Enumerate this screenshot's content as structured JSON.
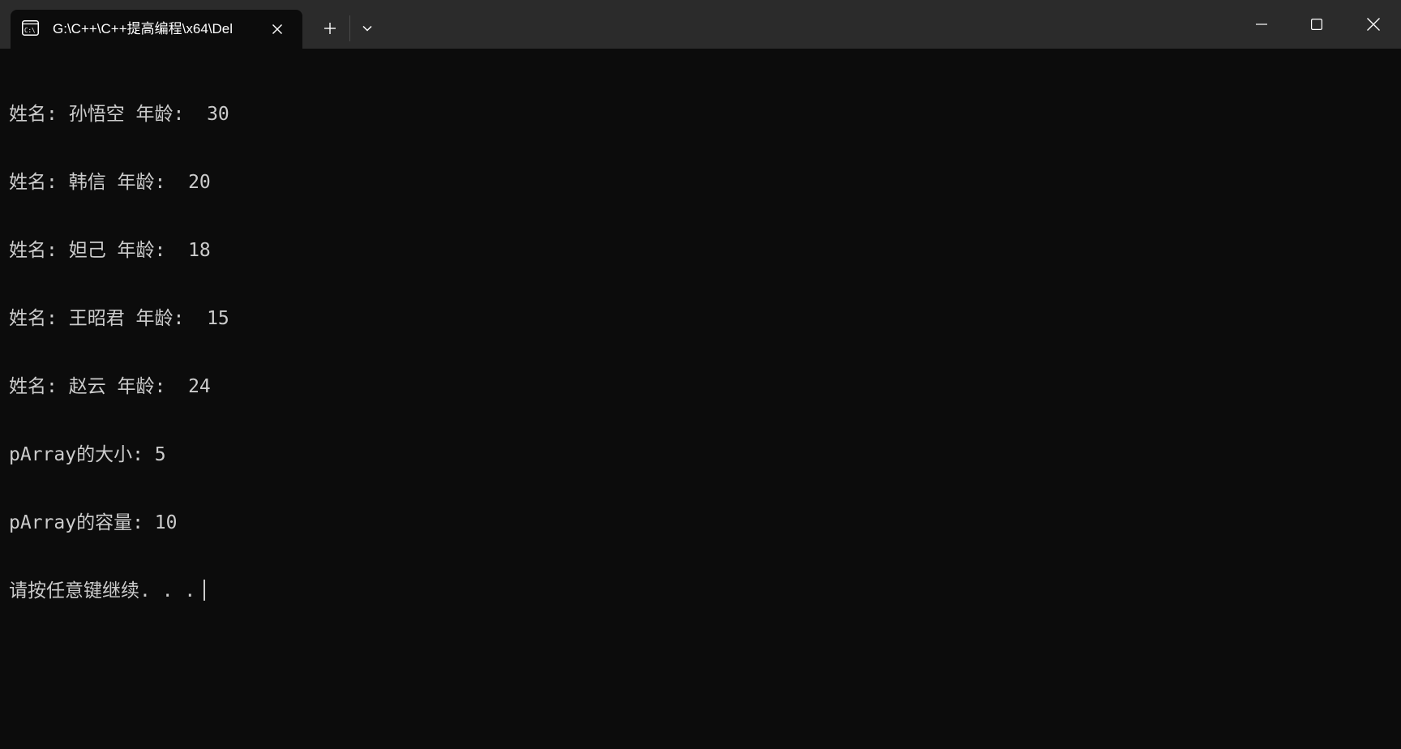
{
  "window": {
    "tab_title": "G:\\C++\\C++提高编程\\x64\\Del",
    "icons": {
      "tab_icon": "console-icon",
      "tab_close": "close-icon",
      "new_tab": "plus-icon",
      "dropdown": "chevron-down-icon",
      "minimize": "minimize-icon",
      "maximize": "maximize-icon",
      "close": "close-icon"
    },
    "colors": {
      "titlebar": "#2b2b2b",
      "background": "#0c0c0c",
      "text": "#cccccc"
    }
  },
  "console": {
    "lines": [
      "姓名: 孙悟空 年龄:  30",
      "姓名: 韩信 年龄:  20",
      "姓名: 妲己 年龄:  18",
      "姓名: 王昭君 年龄:  15",
      "姓名: 赵云 年龄:  24",
      "pArray的大小: 5",
      "pArray的容量: 10",
      "请按任意键继续. . ."
    ]
  }
}
